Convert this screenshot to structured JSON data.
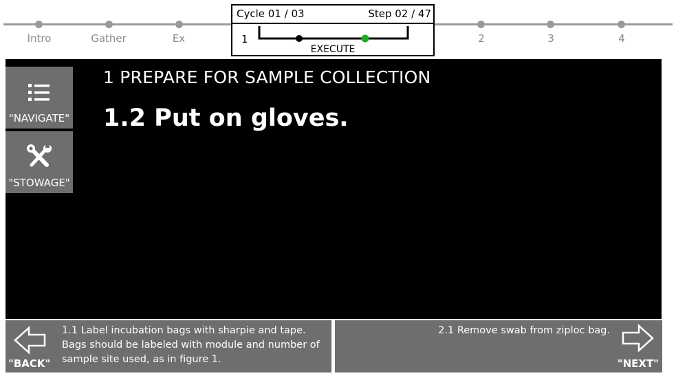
{
  "timeline": {
    "phases": [
      {
        "label": "Intro"
      },
      {
        "label": "Gather"
      },
      {
        "label": "Ex"
      },
      {
        "label": "2"
      },
      {
        "label": "3"
      },
      {
        "label": "4"
      }
    ]
  },
  "cycle_box": {
    "cycle": "Cycle 01 / 03",
    "step": "Step 02 / 47",
    "current_phase": "1",
    "phase_label": "EXECUTE",
    "progress_marker_color": "#22aa22"
  },
  "sidebar": {
    "navigate_label": "\"NAVIGATE\"",
    "stowage_label": "\"STOWAGE\""
  },
  "content": {
    "section": "1 PREPARE FOR SAMPLE COLLECTION",
    "step": "1.2 Put on gloves."
  },
  "footer": {
    "back_label": "\"BACK\"",
    "back_text": "1.1 Label incubation bags with sharpie and tape. Bags should be labeled with module and number of sample site used, as in figure 1.",
    "next_label": "\"NEXT\"",
    "next_text": "2.1 Remove swab from ziploc bag."
  }
}
